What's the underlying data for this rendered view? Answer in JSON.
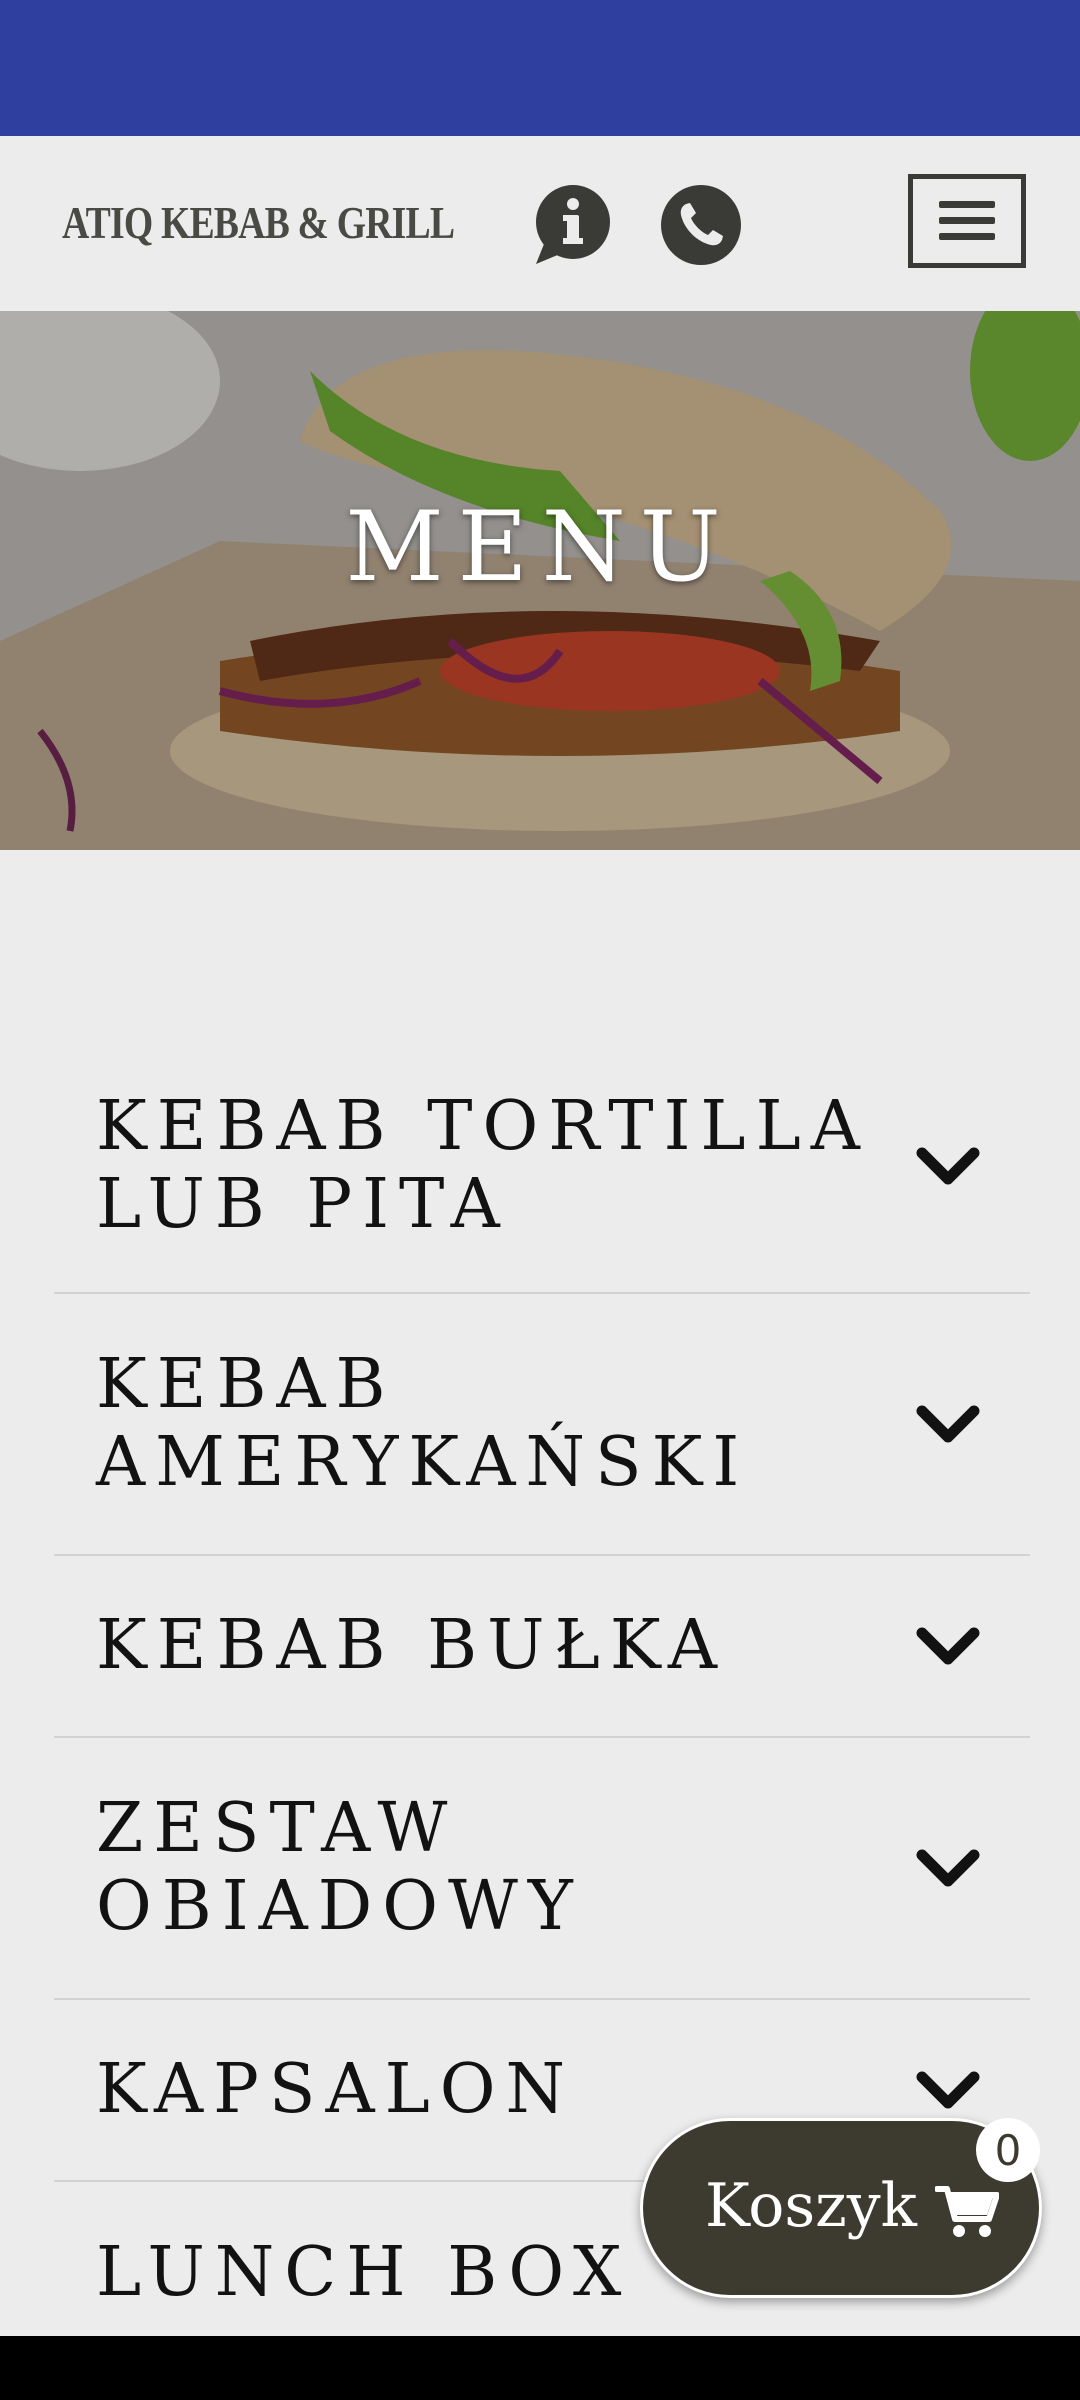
{
  "header": {
    "logo_text": "ATIQ KEBAB & GRILL"
  },
  "hero": {
    "title": "MENU"
  },
  "categories": [
    {
      "label": "KEBAB TORTILLA LUB PITA"
    },
    {
      "label": "KEBAB AMERYKAŃSKI"
    },
    {
      "label": "KEBAB BUŁKA"
    },
    {
      "label": "ZESTAW OBIADOWY"
    },
    {
      "label": "KAPSALON"
    },
    {
      "label": "LUNCH BOX"
    }
  ],
  "cart": {
    "label": "Koszyk",
    "count": "0"
  },
  "icons": {
    "info": "info-bubble-icon",
    "phone": "phone-icon",
    "menu": "hamburger-icon",
    "chevron": "chevron-down-icon",
    "cart": "shopping-cart-icon"
  },
  "colors": {
    "status_bar": "#2f3f9f",
    "header_bg": "#ececec",
    "icon_dark": "#3a3a36",
    "cart_bg": "#3d3b2f"
  }
}
